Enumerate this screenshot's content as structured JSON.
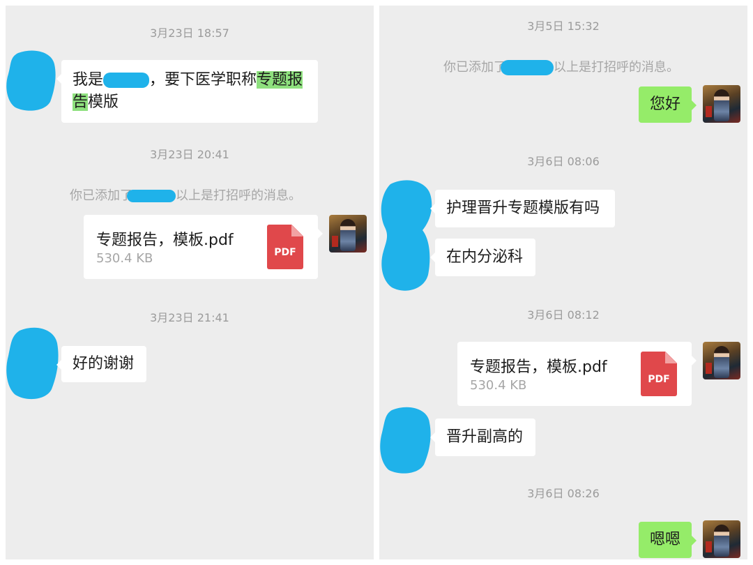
{
  "left_panel": {
    "timestamps": [
      "3月23日 18:57",
      "3月23日 20:41",
      "3月23日 21:41"
    ],
    "msg1": {
      "prefix": "我是",
      "mid": "，要下医学职称",
      "highlight_line1": "专题报",
      "highlight_line2": "告",
      "suffix": "模版"
    },
    "system": {
      "prefix": "你已添加了",
      "suffix": "以上是打招呼的消息。"
    },
    "file": {
      "name": "专题报告，模板.pdf",
      "size": "530.4 KB",
      "icon_label": "PDF"
    },
    "msg2": "好的谢谢"
  },
  "right_panel": {
    "timestamps": [
      "3月5日 15:32",
      "3月6日 08:06",
      "3月6日 08:12",
      "3月6日 08:26"
    ],
    "system": {
      "prefix": "你已添加了",
      "suffix": "以上是打招呼的消息。"
    },
    "msg_hello": "您好",
    "msg_q1": "护理晋升专题模版有吗",
    "msg_q2": "在内分泌科",
    "file": {
      "name": "专题报告，模板.pdf",
      "size": "530.4 KB",
      "icon_label": "PDF"
    },
    "msg_q3": "晋升副高的",
    "msg_ack": "嗯嗯"
  },
  "colors": {
    "chat_background": "#ededed",
    "bubble_green": "#95ec69",
    "redaction_blue": "#1fb2ea",
    "pdf_red": "#e0484b"
  }
}
